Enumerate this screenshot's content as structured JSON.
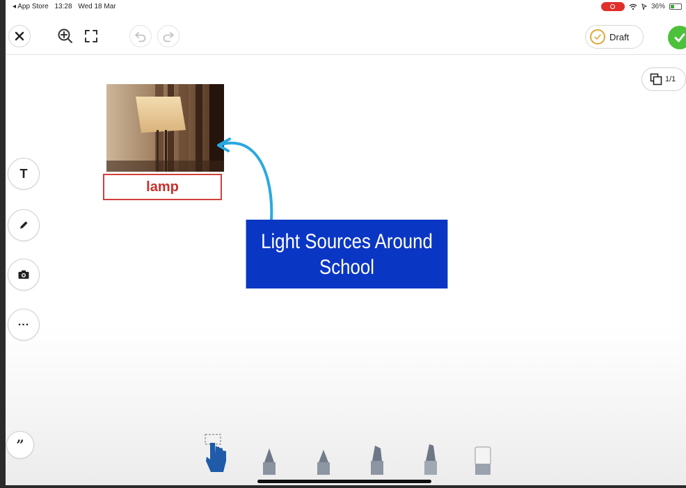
{
  "status_bar": {
    "back_app": "◂ App Store",
    "time": "13:28",
    "date": "Wed 18 Mar",
    "battery": "36%"
  },
  "toolbar": {
    "close": "close",
    "zoom": "zoom-in",
    "fit": "fit-screen",
    "undo": "undo",
    "redo": "redo",
    "draft_label": "Draft"
  },
  "pages": {
    "indicator": "1/1"
  },
  "side_tools": {
    "text_tool": "T",
    "more": "..."
  },
  "canvas": {
    "photo_label": "lamp",
    "title_line1": "Light Sources Around",
    "title_line2": "School",
    "arrow_color": "#2aa8e0"
  },
  "colors": {
    "accent_blue": "#0a36c4",
    "label_red": "#c9302c",
    "done_green": "#4cc13a",
    "record_red": "#e0302c"
  }
}
